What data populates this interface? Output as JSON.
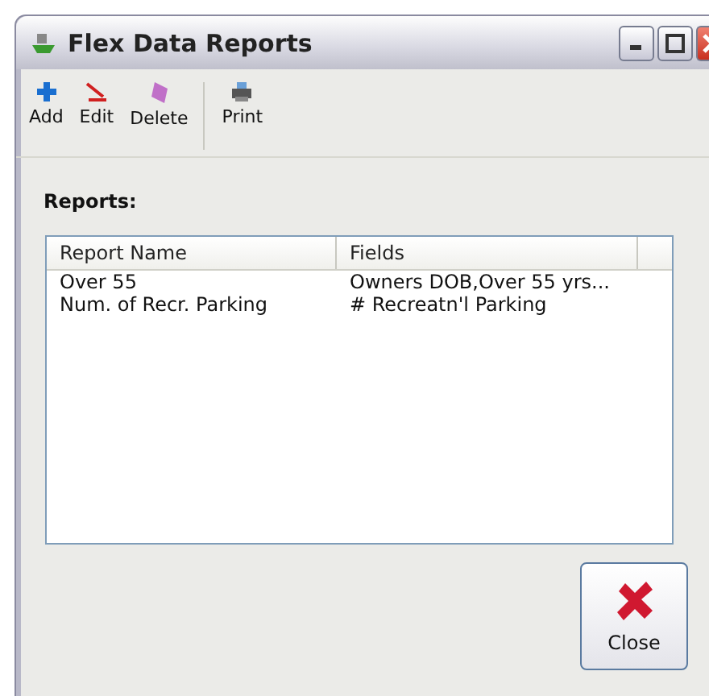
{
  "window": {
    "title": "Flex Data Reports"
  },
  "toolbar": [
    {
      "label": "Add",
      "kind": "add"
    },
    {
      "label": "Edit",
      "kind": "edit"
    },
    {
      "label": "Delete",
      "kind": "delete"
    },
    {
      "label": "Print",
      "kind": "print"
    }
  ],
  "reports_label": "Reports:",
  "table": {
    "columns": [
      "Report Name",
      "Fields"
    ],
    "rows": [
      [
        "Over 55",
        "Owners DOB,Over 55 yrs..."
      ],
      [
        "Num. of Recr. Parking",
        "# Recreatn'l Parking"
      ]
    ]
  },
  "close_button": "Close"
}
